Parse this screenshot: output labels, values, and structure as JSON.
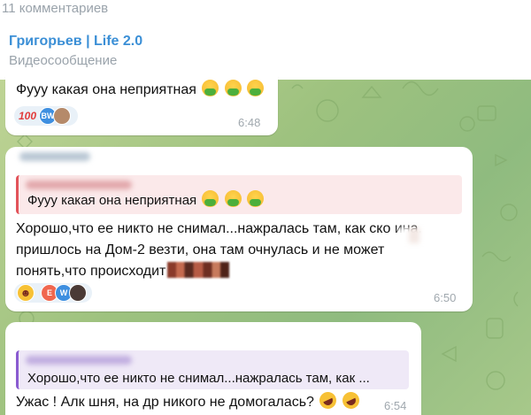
{
  "header": {
    "comments_count": "11 комментариев",
    "channel_name": "Григорьев | Life 2.0",
    "channel_subtitle": "Видеосообщение"
  },
  "messages": [
    {
      "text": "Фууу какая она неприятная",
      "emojis": [
        "nauseated-face",
        "nauseated-face",
        "nauseated-face"
      ],
      "reactions": [
        "100-emoji",
        "BW",
        "avatar"
      ],
      "time": "6:48"
    },
    {
      "quote_text": "Фууу какая она неприятная",
      "lines": [
        "Хорошо,что ее никто не снимал...нажралась там, как ско  ина,",
        "пришлось на Дом-2 везти, она там очнулась и не может",
        "понять,что происходит"
      ],
      "reactions": [
        "grinning-face",
        "E",
        "W",
        "avatar"
      ],
      "time": "6:50"
    },
    {
      "quote_text": "Хорошо,что ее никто не снимал...нажралась там, как ...",
      "text": "Ужас ! Алк  шня, на др никого не домогалась?",
      "emojis": [
        "rofl",
        "rofl"
      ],
      "time": "6:54"
    }
  ],
  "colors": {
    "link_blue": "#3b8fd6",
    "quote_red": "#e2535a",
    "quote_purple": "#8a5bd0",
    "muted_gray": "#9aa3ab"
  }
}
